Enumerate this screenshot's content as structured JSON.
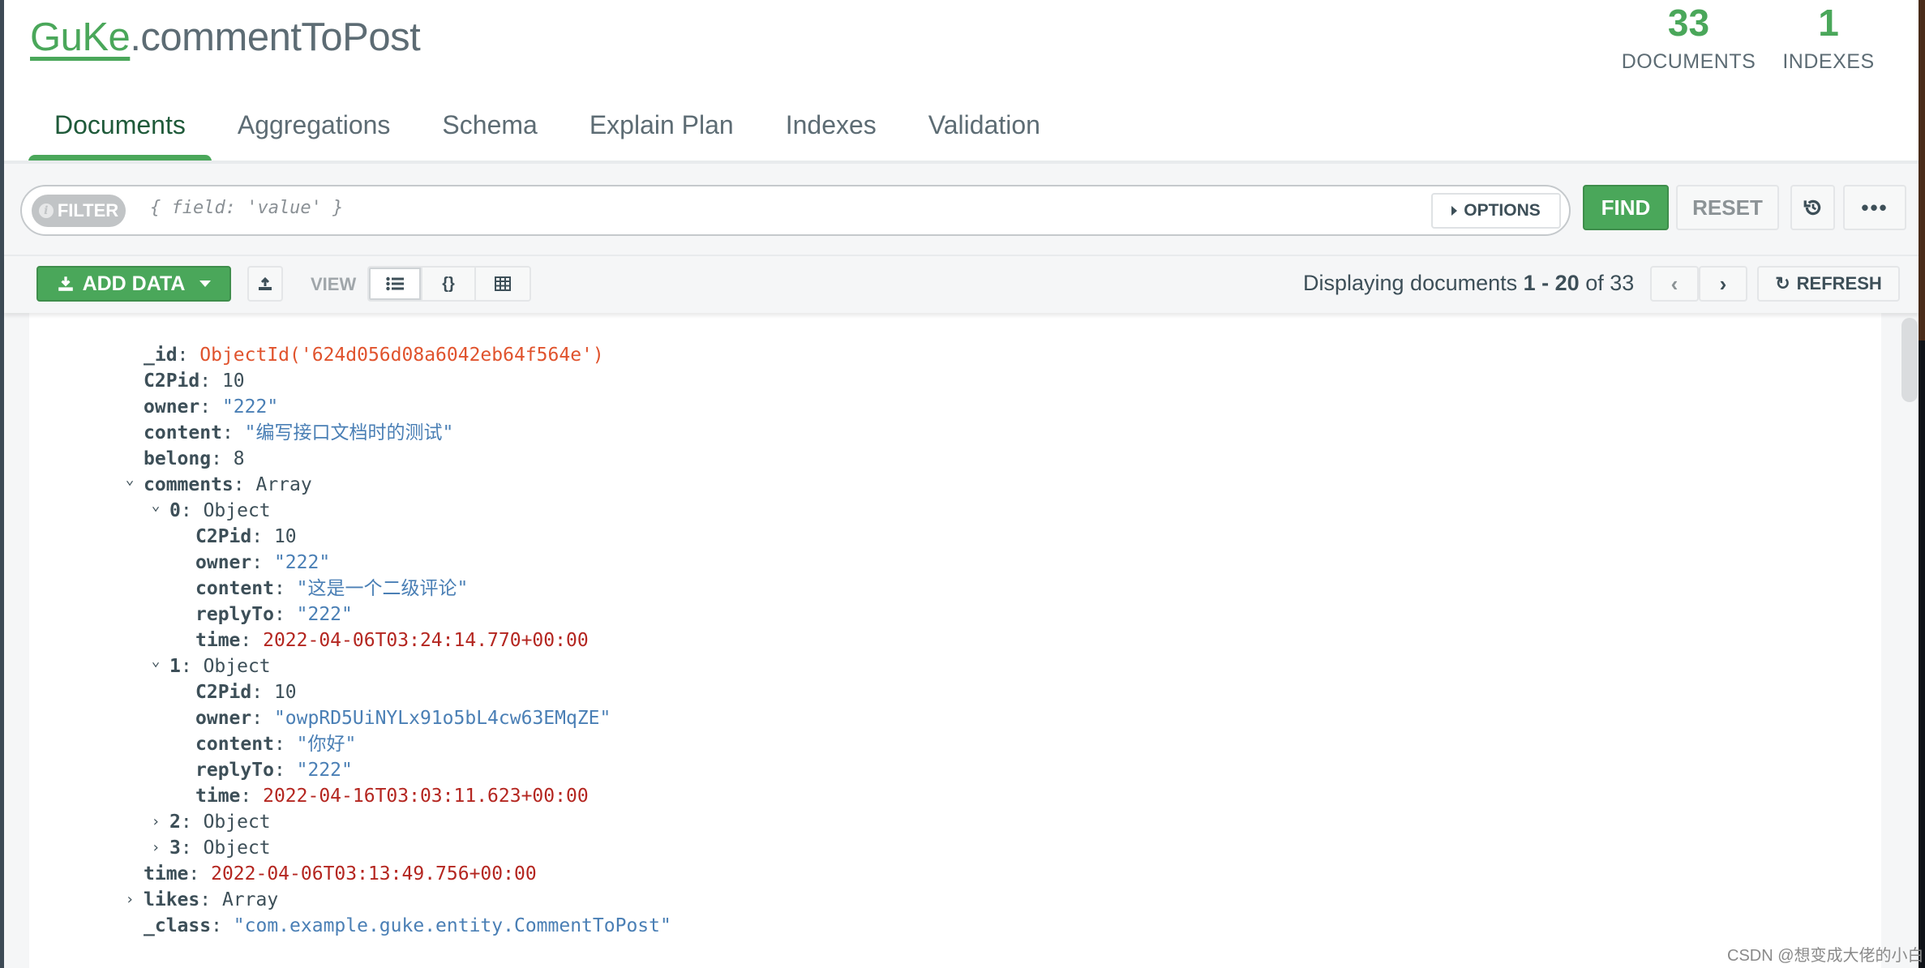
{
  "header": {
    "db_name": "GuKe",
    "collection_name": ".commentToPost",
    "stats": [
      {
        "value": "33",
        "label": "DOCUMENTS"
      },
      {
        "value": "1",
        "label": "INDEXES"
      }
    ]
  },
  "tabs": [
    {
      "label": "Documents",
      "active": true
    },
    {
      "label": "Aggregations",
      "active": false
    },
    {
      "label": "Schema",
      "active": false
    },
    {
      "label": "Explain Plan",
      "active": false
    },
    {
      "label": "Indexes",
      "active": false
    },
    {
      "label": "Validation",
      "active": false
    }
  ],
  "filter": {
    "pill_label": "FILTER",
    "placeholder": "{ field: 'value' }",
    "value": "",
    "options_label": "OPTIONS",
    "find_label": "FIND",
    "reset_label": "RESET",
    "history_icon": "history-icon",
    "more_icon": "ellipsis-icon"
  },
  "toolbar": {
    "add_data_label": "ADD DATA",
    "import_icon": "upload-icon",
    "view_label": "VIEW",
    "views": [
      {
        "name": "list",
        "glyph": "☰",
        "active": true
      },
      {
        "name": "json",
        "glyph": "{}",
        "active": false
      },
      {
        "name": "table",
        "glyph": "▦",
        "active": false
      }
    ],
    "paging": {
      "prefix": "Displaying documents ",
      "range": "1 - 20",
      "middle": " of ",
      "total": "33"
    },
    "refresh_label": "REFRESH"
  },
  "document": {
    "rows": [
      {
        "indent": 0,
        "key": "_id",
        "value": "ObjectId('624d056d08a6042eb64f564e')",
        "type": "oid"
      },
      {
        "indent": 0,
        "key": "C2Pid",
        "value": "10",
        "type": "num"
      },
      {
        "indent": 0,
        "key": "owner",
        "value": "\"222\"",
        "type": "str"
      },
      {
        "indent": 0,
        "key": "content",
        "value": "\"编写接口文档时的测试\"",
        "type": "str"
      },
      {
        "indent": 0,
        "key": "belong",
        "value": "8",
        "type": "num"
      },
      {
        "indent": 0,
        "key": "comments",
        "value": "Array",
        "type": "type",
        "caret": "expanded"
      },
      {
        "indent": 1,
        "key": "0",
        "value": "Object",
        "type": "type",
        "caret": "expanded"
      },
      {
        "indent": 2,
        "key": "C2Pid",
        "value": "10",
        "type": "num"
      },
      {
        "indent": 2,
        "key": "owner",
        "value": "\"222\"",
        "type": "str"
      },
      {
        "indent": 2,
        "key": "content",
        "value": "\"这是一个二级评论\"",
        "type": "str"
      },
      {
        "indent": 2,
        "key": "replyTo",
        "value": "\"222\"",
        "type": "str"
      },
      {
        "indent": 2,
        "key": "time",
        "value": "2022-04-06T03:24:14.770+00:00",
        "type": "date"
      },
      {
        "indent": 1,
        "key": "1",
        "value": "Object",
        "type": "type",
        "caret": "expanded"
      },
      {
        "indent": 2,
        "key": "C2Pid",
        "value": "10",
        "type": "num"
      },
      {
        "indent": 2,
        "key": "owner",
        "value": "\"owpRD5UiNYLx91o5bL4cw63EMqZE\"",
        "type": "str"
      },
      {
        "indent": 2,
        "key": "content",
        "value": "\"你好\"",
        "type": "str"
      },
      {
        "indent": 2,
        "key": "replyTo",
        "value": "\"222\"",
        "type": "str"
      },
      {
        "indent": 2,
        "key": "time",
        "value": "2022-04-16T03:03:11.623+00:00",
        "type": "date"
      },
      {
        "indent": 1,
        "key": "2",
        "value": "Object",
        "type": "type",
        "caret": "collapsed"
      },
      {
        "indent": 1,
        "key": "3",
        "value": "Object",
        "type": "type",
        "caret": "collapsed"
      },
      {
        "indent": 0,
        "key": "time",
        "value": "2022-04-06T03:13:49.756+00:00",
        "type": "date"
      },
      {
        "indent": 0,
        "key": "likes",
        "value": "Array",
        "type": "type",
        "caret": "collapsed"
      },
      {
        "indent": 0,
        "key": "_class",
        "value": "\"com.example.guke.entity.CommentToPost\"",
        "type": "str"
      }
    ]
  },
  "watermark": "CSDN @想变成大佬的小白"
}
